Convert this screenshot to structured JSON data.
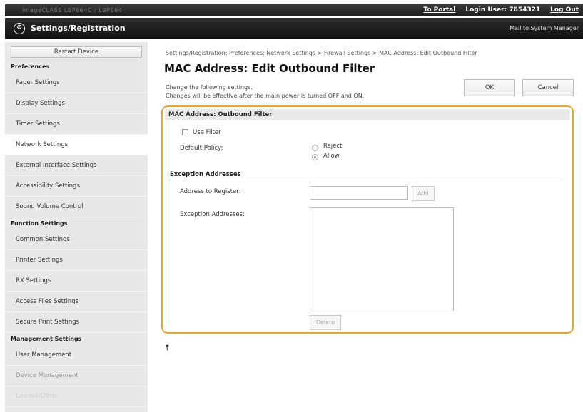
{
  "topbar": {
    "left_text": "imageCLASS  LBP664C / LBP664",
    "portal": "To Portal",
    "login_label": "Login User:",
    "login_user": "7654321",
    "logout": "Log Out"
  },
  "titlebar": {
    "title": "Settings/Registration",
    "mail": "Mail to System Manager"
  },
  "sidebar": {
    "restart": "Restart Device",
    "sections": [
      {
        "header": "Preferences",
        "items": [
          "Paper Settings",
          "Display Settings",
          "Timer Settings",
          "Network Settings",
          "External Interface Settings",
          "Accessibility Settings",
          "Sound Volume Control"
        ]
      },
      {
        "header": "Function Settings",
        "items": [
          "Common Settings",
          "Printer Settings",
          "RX Settings",
          "Access Files Settings",
          "Secure Print Settings"
        ]
      },
      {
        "header": "Management Settings",
        "items": [
          "User Management",
          "Device Management",
          "License/Other"
        ]
      }
    ],
    "active_item": "Network Settings"
  },
  "main": {
    "breadcrumb": "Settings/Registration: Preferences: Network Settings > Firewall Settings > MAC Address: Edit Outbound Filter",
    "title": "MAC Address: Edit Outbound Filter",
    "instruction_1": "Change the following settings.",
    "instruction_2": "Changes will be effective after the main power is turned OFF and ON.",
    "ok": "OK",
    "cancel": "Cancel",
    "panel": {
      "header": "MAC Address: Outbound Filter",
      "use_filter": "Use Filter",
      "use_filter_checked": false,
      "default_policy_label": "Default Policy:",
      "policy_reject": "Reject",
      "policy_allow": "Allow",
      "policy_selected": "Allow",
      "exception_title": "Exception Addresses",
      "address_label": "Address to Register:",
      "address_value": "",
      "add": "Add",
      "exceptions_label": "Exception Addresses:",
      "delete": "Delete"
    },
    "top_link": "⤒"
  }
}
